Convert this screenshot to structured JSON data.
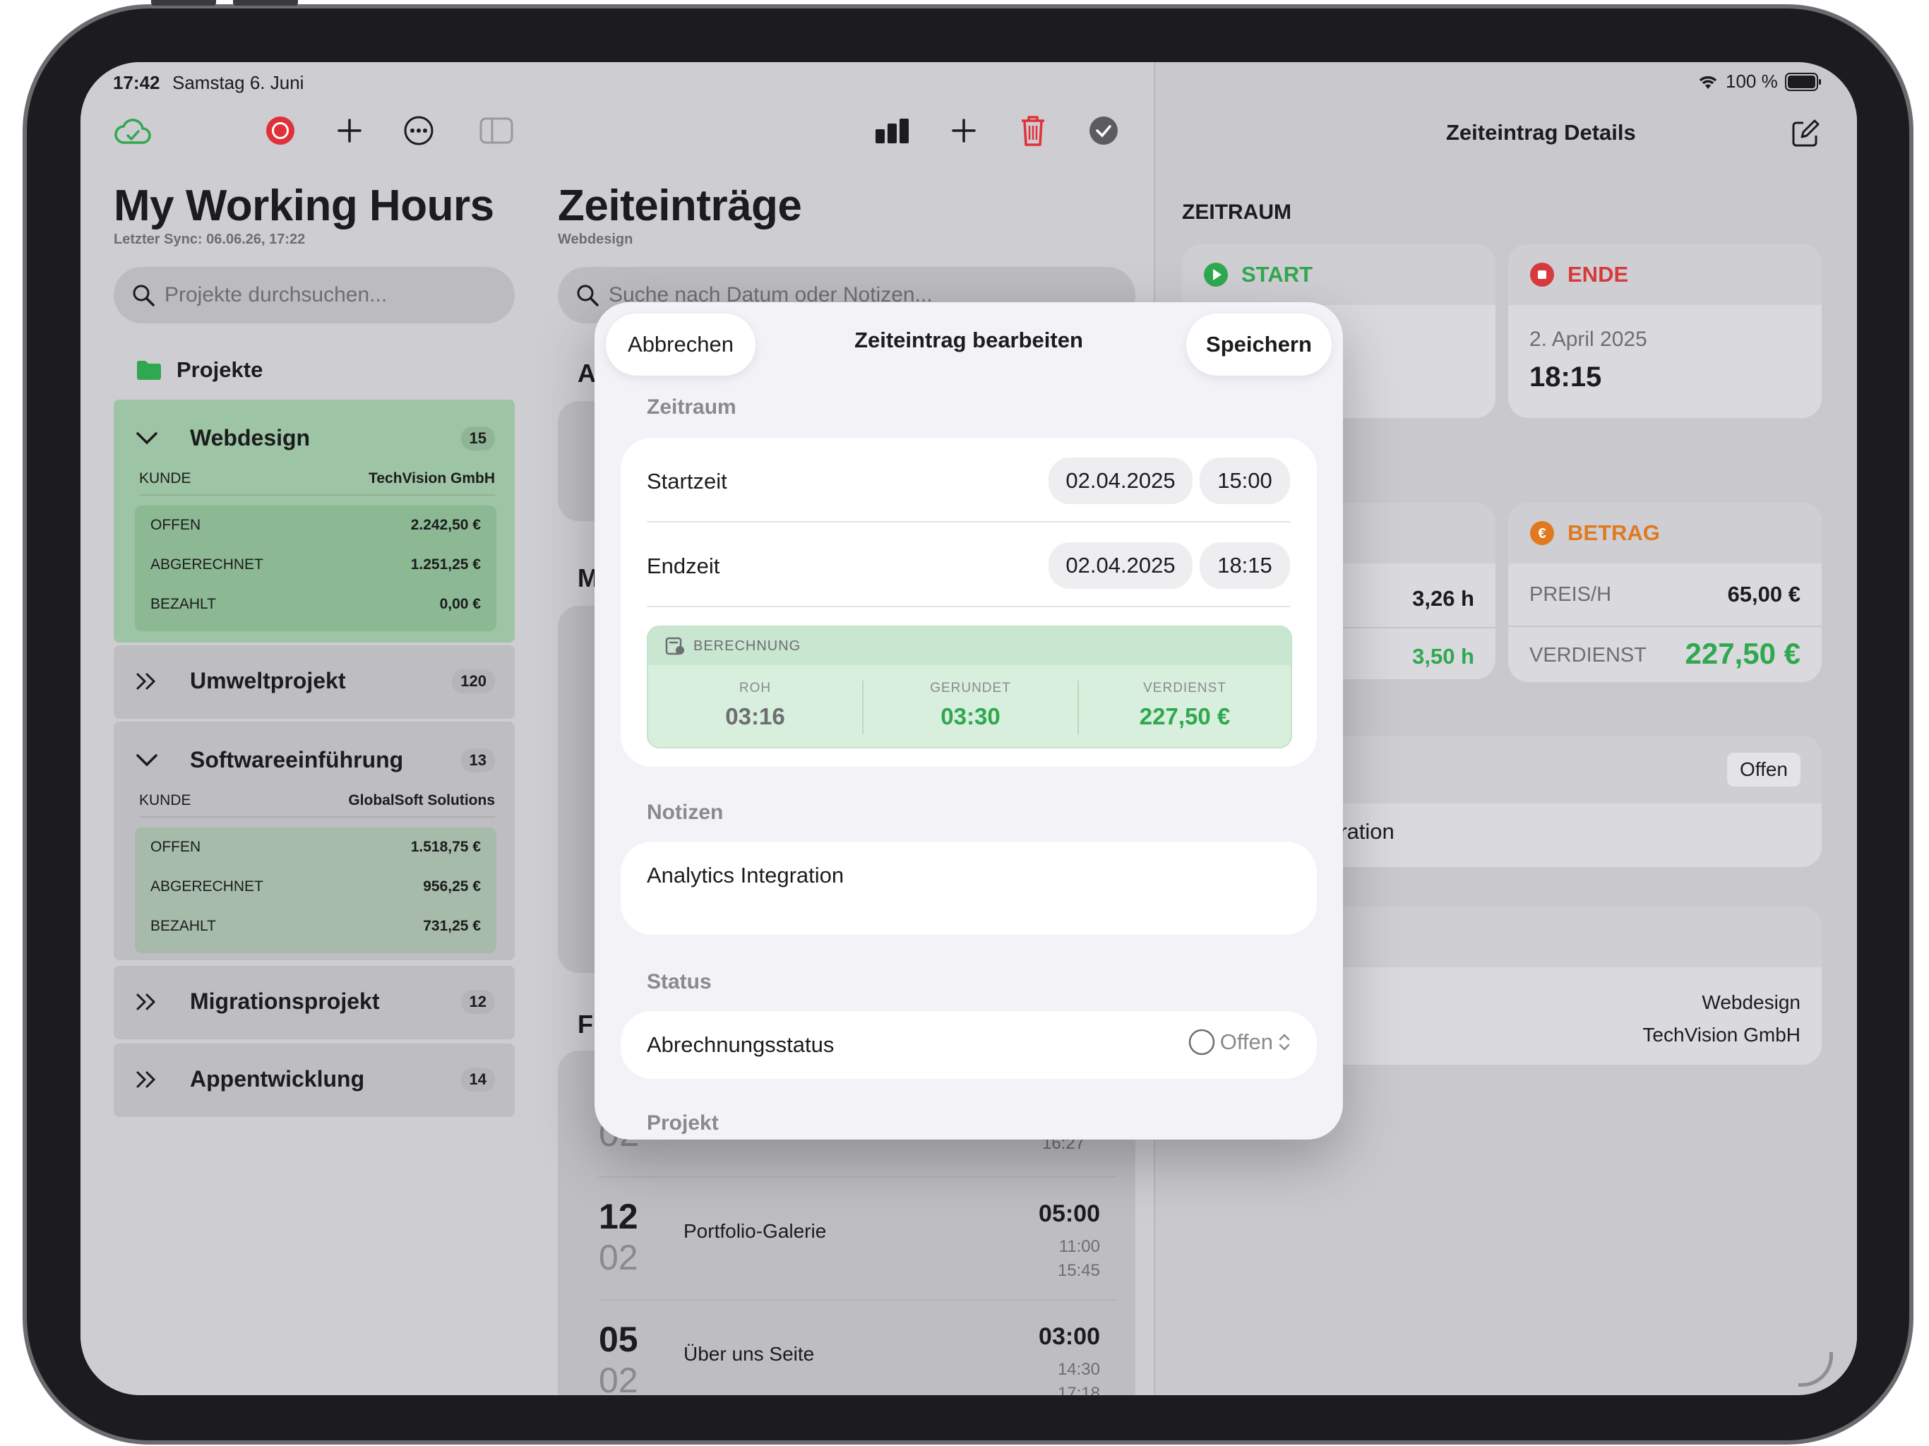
{
  "status_bar": {
    "time": "17:42",
    "date": "Samstag 6. Juni",
    "battery": "100 %"
  },
  "sidebar": {
    "title": "My Working Hours",
    "sync": "Letzter Sync: 06.06.26, 17:22",
    "search_placeholder": "Projekte durchsuchen...",
    "section": "Projekte",
    "projects": [
      {
        "name": "Webdesign",
        "count": "15",
        "customer_label": "KUNDE",
        "customer": "TechVision GmbH",
        "stats": [
          {
            "label": "OFFEN",
            "value": "2.242,50 €"
          },
          {
            "label": "ABGERECHNET",
            "value": "1.251,25 €"
          },
          {
            "label": "BEZAHLT",
            "value": "0,00 €"
          }
        ]
      },
      {
        "name": "Umweltprojekt",
        "count": "120"
      },
      {
        "name": "Softwareeinführung",
        "count": "13",
        "customer_label": "KUNDE",
        "customer": "GlobalSoft Solutions",
        "stats": [
          {
            "label": "OFFEN",
            "value": "1.518,75 €"
          },
          {
            "label": "ABGERECHNET",
            "value": "956,25 €"
          },
          {
            "label": "BEZAHLT",
            "value": "731,25 €"
          }
        ]
      },
      {
        "name": "Migrationsprojekt",
        "count": "12"
      },
      {
        "name": "Appentwicklung",
        "count": "14"
      }
    ]
  },
  "list": {
    "title": "Zeiteinträge",
    "subtitle": "Webdesign",
    "search_placeholder": "Suche nach Datum oder Notizen...",
    "section_a": "A",
    "section_m": "M",
    "section_f": "F",
    "partial_entry": {
      "day": "02",
      "end": "16:27"
    },
    "entries": [
      {
        "day": "12",
        "month": "02",
        "title": "Portfolio-Galerie",
        "duration": "05:00",
        "start": "11:00",
        "end": "15:45"
      },
      {
        "day": "05",
        "month": "02",
        "title": "Über uns Seite",
        "duration": "03:00",
        "start": "14:30",
        "end": "17:18"
      }
    ]
  },
  "detail": {
    "title": "Zeiteintrag Details",
    "section": "ZEITRAUM",
    "start_label": "START",
    "end_label": "ENDE",
    "end_date": "2. April 2025",
    "end_time": "18:15",
    "hours_label_partial": "N",
    "hours_raw": "3,26 h",
    "hours_rounded": "3,50 h",
    "amount_label": "BETRAG",
    "rate_label": "PREIS/H",
    "rate_value": "65,00 €",
    "earn_label": "VERDIENST",
    "earn_value": "227,50 €",
    "status_badge": "Offen",
    "notes_partial": "gration",
    "project": "Webdesign",
    "customer": "TechVision GmbH"
  },
  "modal": {
    "cancel": "Abbrechen",
    "title": "Zeiteintrag bearbeiten",
    "save": "Speichern",
    "period_header": "Zeitraum",
    "start_label": "Startzeit",
    "start_date": "02.04.2025",
    "start_time": "15:00",
    "end_label": "Endzeit",
    "end_date": "02.04.2025",
    "end_time": "18:15",
    "calc": {
      "header": "BERECHNUNG",
      "raw_label": "ROH",
      "raw_value": "03:16",
      "rounded_label": "GERUNDET",
      "rounded_value": "03:30",
      "earn_label": "VERDIENST",
      "earn_value": "227,50 €"
    },
    "notes_header": "Notizen",
    "notes": "Analytics Integration",
    "status_header": "Status",
    "status_label": "Abrechnungsstatus",
    "status_value": "Offen",
    "project_header": "Projekt"
  },
  "colors": {
    "accent_green": "#2fa84f",
    "record_red": "#e0313a",
    "end_red": "#d63a3a",
    "amount_orange": "#e07a21",
    "trash_red": "#e0313a"
  }
}
